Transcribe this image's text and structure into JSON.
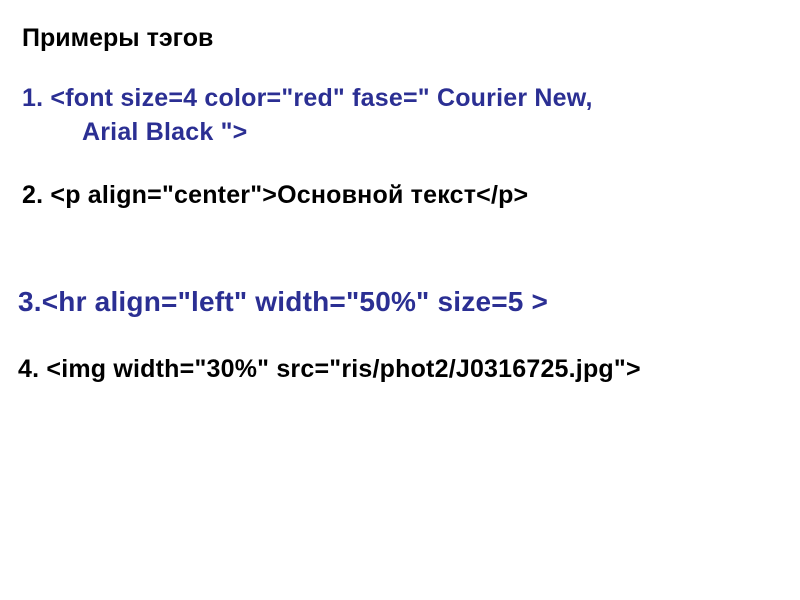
{
  "title": "Примеры тэгов",
  "items": {
    "i1_line1": "1.   <font size=4 color=\"red\" fase=\" Courier New,",
    "i1_line2": "Arial Black \">",
    "i2": "2.     <p align=\"center\">Основной текст</p>",
    "i3": "3.<hr align=\"left\" width=\"50%\"    size=5 >",
    "i4": "4.  <img  width=\"30%\"  src=\"ris/phot2/J0316725.jpg\">"
  }
}
